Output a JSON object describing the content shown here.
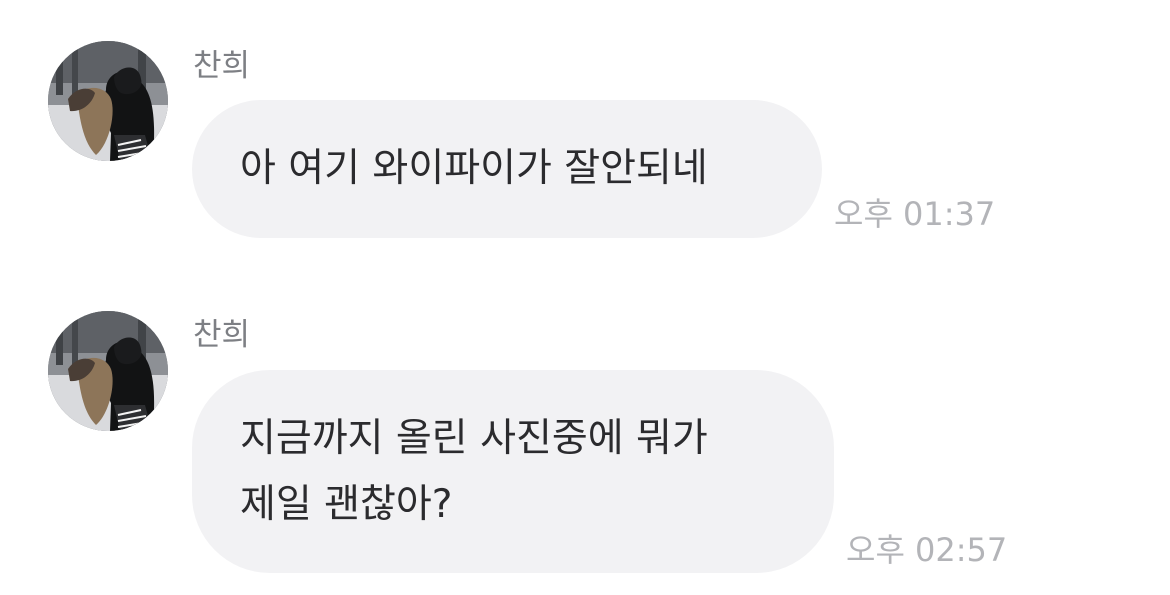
{
  "messages": [
    {
      "sender": "찬희",
      "lines": [
        "아 여기 와이파이가 잘안되네"
      ],
      "time": "오후 01:37"
    },
    {
      "sender": "찬희",
      "lines": [
        "지금까지 올린 사진중에 뭐가",
        "제일 괜찮아?"
      ],
      "time": "오후 02:57"
    }
  ],
  "colors": {
    "bubble_background": "#f2f2f4",
    "message_text": "#2b2b2e",
    "sender_text": "#7d7f84",
    "timestamp_text": "#b3b4b8"
  }
}
